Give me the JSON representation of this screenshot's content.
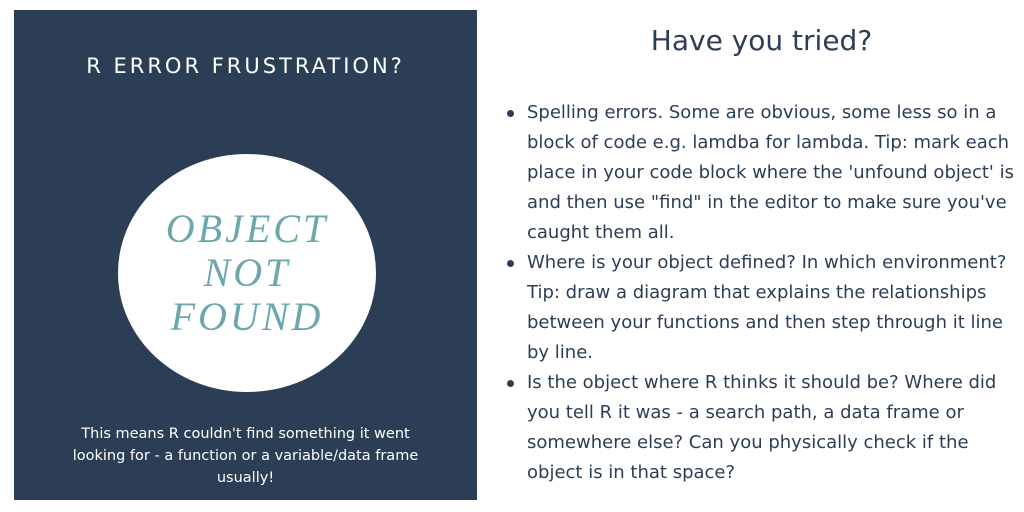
{
  "left_panel": {
    "heading": "R ERROR FRUSTRATION?",
    "circle_lines": [
      "OBJECT",
      "NOT",
      "FOUND"
    ],
    "caption": "This means R couldn't find something it went looking for - a function or a variable/data frame usually!"
  },
  "right_panel": {
    "title": "Have you tried?",
    "tips": [
      "Spelling errors. Some are obvious, some less so in a block of code e.g. lamdba for lambda. Tip: mark each place in your code block where the 'unfound object' is and then use \"find\" in the editor to make sure you've caught them all.",
      "Where is your object defined? In which environment? Tip: draw a diagram that explains the relationships between your functions and then step through it line by line.",
      "Is the object where R thinks it should be? Where did you tell R it was - a search path, a data frame or somewhere else? Can you physically check if the object is in that space?"
    ]
  },
  "colors": {
    "panel_background": "#2c3e55",
    "accent_text": "#6ba7ad",
    "body_text": "#2c3e55"
  }
}
